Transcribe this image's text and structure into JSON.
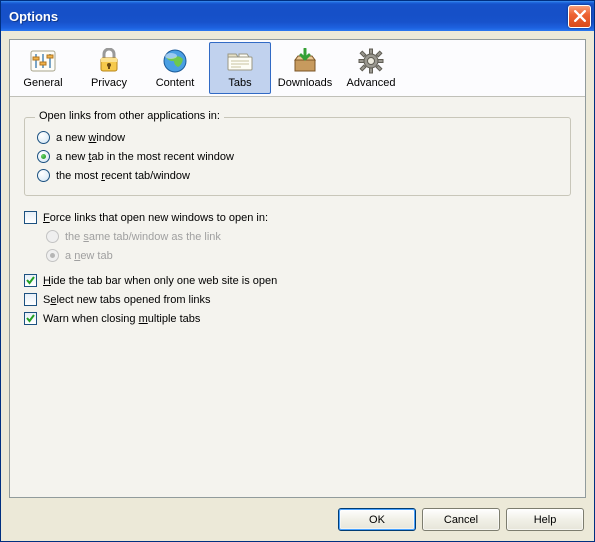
{
  "window": {
    "title": "Options"
  },
  "categories": [
    {
      "key": "general",
      "label": "General"
    },
    {
      "key": "privacy",
      "label": "Privacy"
    },
    {
      "key": "content",
      "label": "Content"
    },
    {
      "key": "tabs",
      "label": "Tabs",
      "selected": true
    },
    {
      "key": "downloads",
      "label": "Downloads"
    },
    {
      "key": "advanced",
      "label": "Advanced"
    }
  ],
  "tabs_page": {
    "open_links_group": {
      "legend": "Open links from other applications in:",
      "options": {
        "new_window": "a new window",
        "new_tab": "a new tab in the most recent window",
        "most_recent": "the most recent tab/window"
      },
      "selected": "new_tab"
    },
    "force_open": {
      "label": "Force links that open new windows to open in:",
      "checked": false,
      "sub": {
        "same_tab": "the same tab/window as the link",
        "new_tab": "a new tab",
        "selected": "new_tab"
      }
    },
    "hide_tab_bar": {
      "label": "Hide the tab bar when only one web site is open",
      "checked": true
    },
    "select_new": {
      "label": "Select new tabs opened from links",
      "checked": false
    },
    "warn_multiple": {
      "label": "Warn when closing multiple tabs",
      "checked": true
    }
  },
  "buttons": {
    "ok": "OK",
    "cancel": "Cancel",
    "help": "Help"
  }
}
